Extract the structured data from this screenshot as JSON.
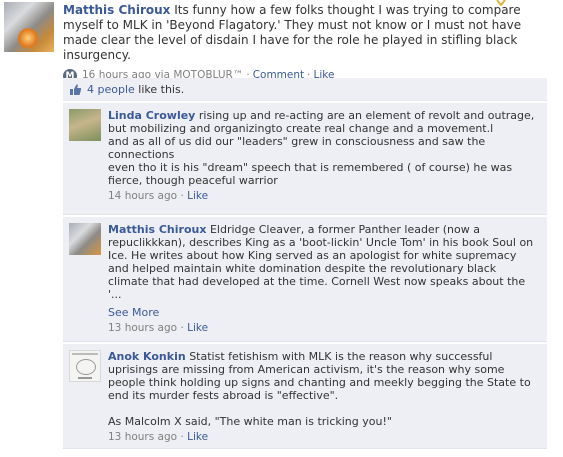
{
  "post": {
    "author": "Matthis Chiroux",
    "text": "Its funny how a few folks thought I was trying to compare myself to MLK in 'Beyond Flagatory.' They must not know or I must not have made clear the level of disdain I have for the role he played in stifling black insurgency.",
    "time": "16 hours ago",
    "via": "via MOTOBLUR™",
    "comment_label": "Comment",
    "like_label": "Like",
    "separator": "·"
  },
  "likes": {
    "count_link": "4 people",
    "suffix": "like this."
  },
  "comments": [
    {
      "author": "Linda Crowley",
      "lines": [
        "rising up and re-acting are an element of revolt and outrage, but mobilizing and organizingto create real change and a movement.l",
        "and as all of us did our \"leaders\" grew in consciousness and saw the connections",
        "even tho it is his \"dream\" speech that is remembered ( of course) he was fierce, though peaceful warrior"
      ],
      "time": "14 hours ago",
      "like_label": "Like"
    },
    {
      "author": "Matthis Chiroux",
      "text": "Eldridge Cleaver, a former Panther leader (now a repuclikkkan), describes King as a 'boot-lickin' Uncle Tom' in his book Soul on Ice. He writes about how King served as an apologist for white supremacy and helped maintain white domination despite the revolutionary black climate that had developed at the time. Cornell West now speaks about the '...",
      "see_more": "See More",
      "time": "13 hours ago",
      "like_label": "Like"
    },
    {
      "author": "Anok Konkin",
      "text": "Statist fetishism with MLK is the reason why successful uprisings are missing from American activism, it's the reason why some people think holding up signs and chanting and meekly begging the State to end its murder fests abroad is \"effective\".",
      "text2": "As Malcolm X said, \"The white man is tricking you!\"",
      "time": "13 hours ago",
      "like_label": "Like"
    }
  ],
  "colors": {
    "link": "#3b5998",
    "ufi_bg": "#edeff4",
    "meta": "#808080"
  },
  "icons": {
    "platform": "motorola-icon",
    "likes": "thumbs-up-icon"
  }
}
